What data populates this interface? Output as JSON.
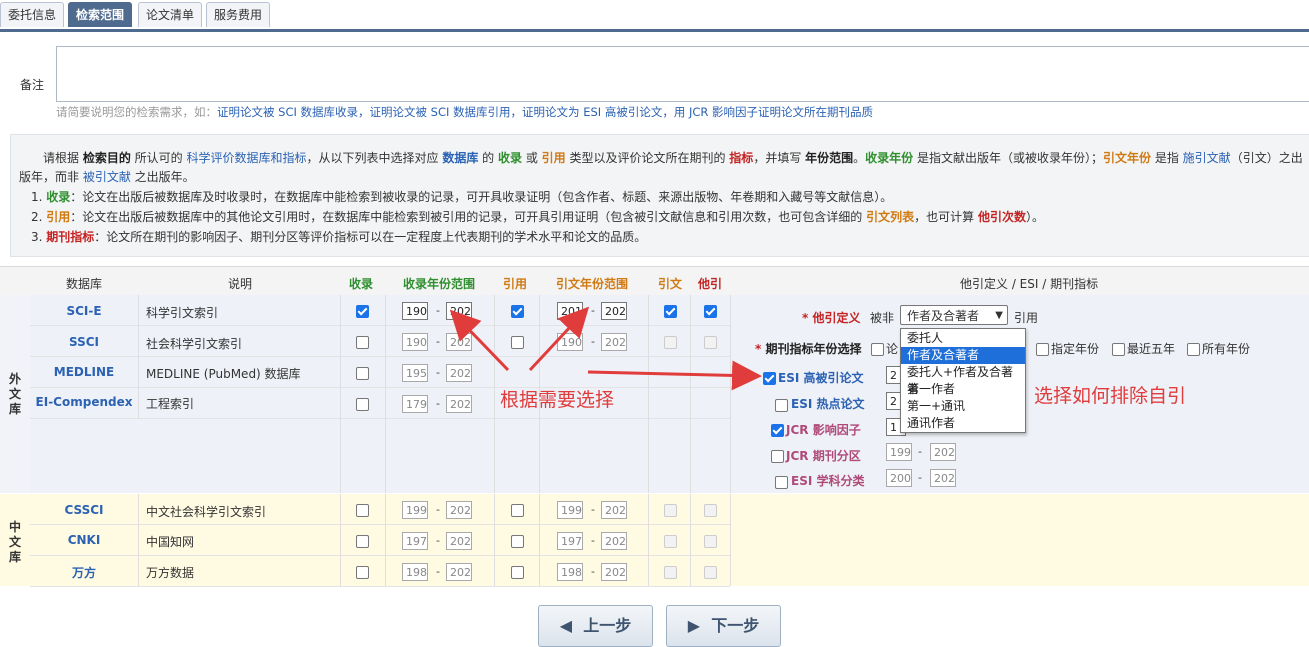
{
  "tabs": [
    "委托信息",
    "检索范围",
    "论文清单",
    "服务费用"
  ],
  "remark": {
    "label": "备注",
    "hint_prefix": "请简要说明您的检索需求，如：",
    "hint_examples": "证明论文被 SCI 数据库收录，证明论文被 SCI 数据库引用，证明论文为 ESI 高被引论文，用 JCR 影响因子证明论文所在期刊品质"
  },
  "instructions": {
    "l1": [
      "请根据 ",
      "检索目的",
      " 所认可的 ",
      "科学评价数据库和指标",
      "，从以下列表中选择对应 ",
      "数据库",
      " 的 ",
      "收录",
      " 或 ",
      "引用",
      " 类型以及评价论文所在期刊的 ",
      "指标",
      "，并填写 ",
      "年份范围",
      "。",
      "收录年份",
      " 是指文献出版年（或被收录年份）；",
      "引文年份",
      " 是指 ",
      "施引文献",
      "（引文）之出"
    ],
    "l2": [
      "版年，而非 ",
      "被引文献",
      " 之出版年。"
    ],
    "i1": [
      "1. ",
      "收录",
      "：论文在出版后被数据库及时收录时，在数据库中能检索到被收录的记录，可开具收录证明（包含作者、标题、来源出版物、年卷期和入藏号等文献信息）。"
    ],
    "i2": [
      "2. ",
      "引用",
      "：论文在出版后被数据库中的其他论文引用时，在数据库中能检索到被引用的记录，可开具引用证明（包含被引文献信息和引用次数，也可包含详细的 ",
      "引文列表",
      "，也可计算 ",
      "他引次数",
      "）。"
    ],
    "i3": [
      "3. ",
      "期刊指标",
      "：论文所在期刊的影响因子、期刊分区等评价指标可以在一定程度上代表期刊的学术水平和论文的品质。"
    ]
  },
  "table_headers": [
    "数据库",
    "说明",
    "收录",
    "收录年份范围",
    "引用",
    "引文年份范围",
    "引文",
    "他引",
    "他引定义 / ESI / 期刊指标"
  ],
  "foreign_label": [
    "外",
    "文",
    "库"
  ],
  "cn_label": [
    "中",
    "文",
    "库"
  ],
  "foreign_rows": [
    {
      "name": "SCI-E",
      "desc": "科学引文索引",
      "inc_y1": "190",
      "inc_y2": "202",
      "cit_y1": "201",
      "cit_y2": "202"
    },
    {
      "name": "SSCI",
      "desc": "社会科学引文索引",
      "inc_y1": "190",
      "inc_y2": "202",
      "cit_y1": "190",
      "cit_y2": "202"
    },
    {
      "name": "MEDLINE",
      "desc": "MEDLINE (PubMed) 数据库",
      "inc_y1": "195",
      "inc_y2": "202"
    },
    {
      "name": "EI-Compendex",
      "desc": "工程索引",
      "inc_y1": "179",
      "inc_y2": "202"
    }
  ],
  "cn_rows": [
    {
      "name": "CSSCI",
      "desc": "中文社会科学引文索引",
      "inc_y1": "199",
      "inc_y2": "202",
      "cit_y1": "199",
      "cit_y2": "202"
    },
    {
      "name": "CNKI",
      "desc": "中国知网",
      "inc_y1": "197",
      "inc_y2": "202",
      "cit_y1": "197",
      "cit_y2": "202"
    },
    {
      "name": "万方",
      "desc": "万方数据",
      "inc_y1": "198",
      "inc_y2": "202",
      "cit_y1": "198",
      "cit_y2": "202"
    }
  ],
  "right_panel": {
    "other_cite_label": "他引定义",
    "bei_fei": "被非",
    "selected": "作者及合著者",
    "yin_yong": "引用",
    "year_label": "期刊指标年份选择",
    "year_opt_partial": "论",
    "year_options": [
      "指定年份",
      "最近五年",
      "所有年份"
    ],
    "esi_high": "ESI 高被引论文",
    "esi_hot": "ESI 热点论文",
    "jcr_if": "JCR 影响因子",
    "jcr_q": "JCR 期刊分区",
    "esi_cat": "ESI 学科分类",
    "esi_high_year": "2",
    "esi_hot_year": "2",
    "jcr_if_year": "1",
    "jcr_q_y1": "199",
    "jcr_q_y2": "202",
    "esi_cat_y1": "200",
    "esi_cat_y2": "202"
  },
  "dropdown_options": [
    "委托人",
    "作者及合著者",
    "委托人+作者及合著者",
    "第一作者",
    "第一+通讯",
    "通讯作者"
  ],
  "annotations": {
    "choose": "根据需要选择",
    "exclude": "选择如何排除自引"
  },
  "buttons": {
    "prev": "上一步",
    "next": "下一步"
  },
  "colors": {
    "accent": "#4f6a8f",
    "link": "#2b62b3",
    "annotation": "#e03c3c"
  }
}
